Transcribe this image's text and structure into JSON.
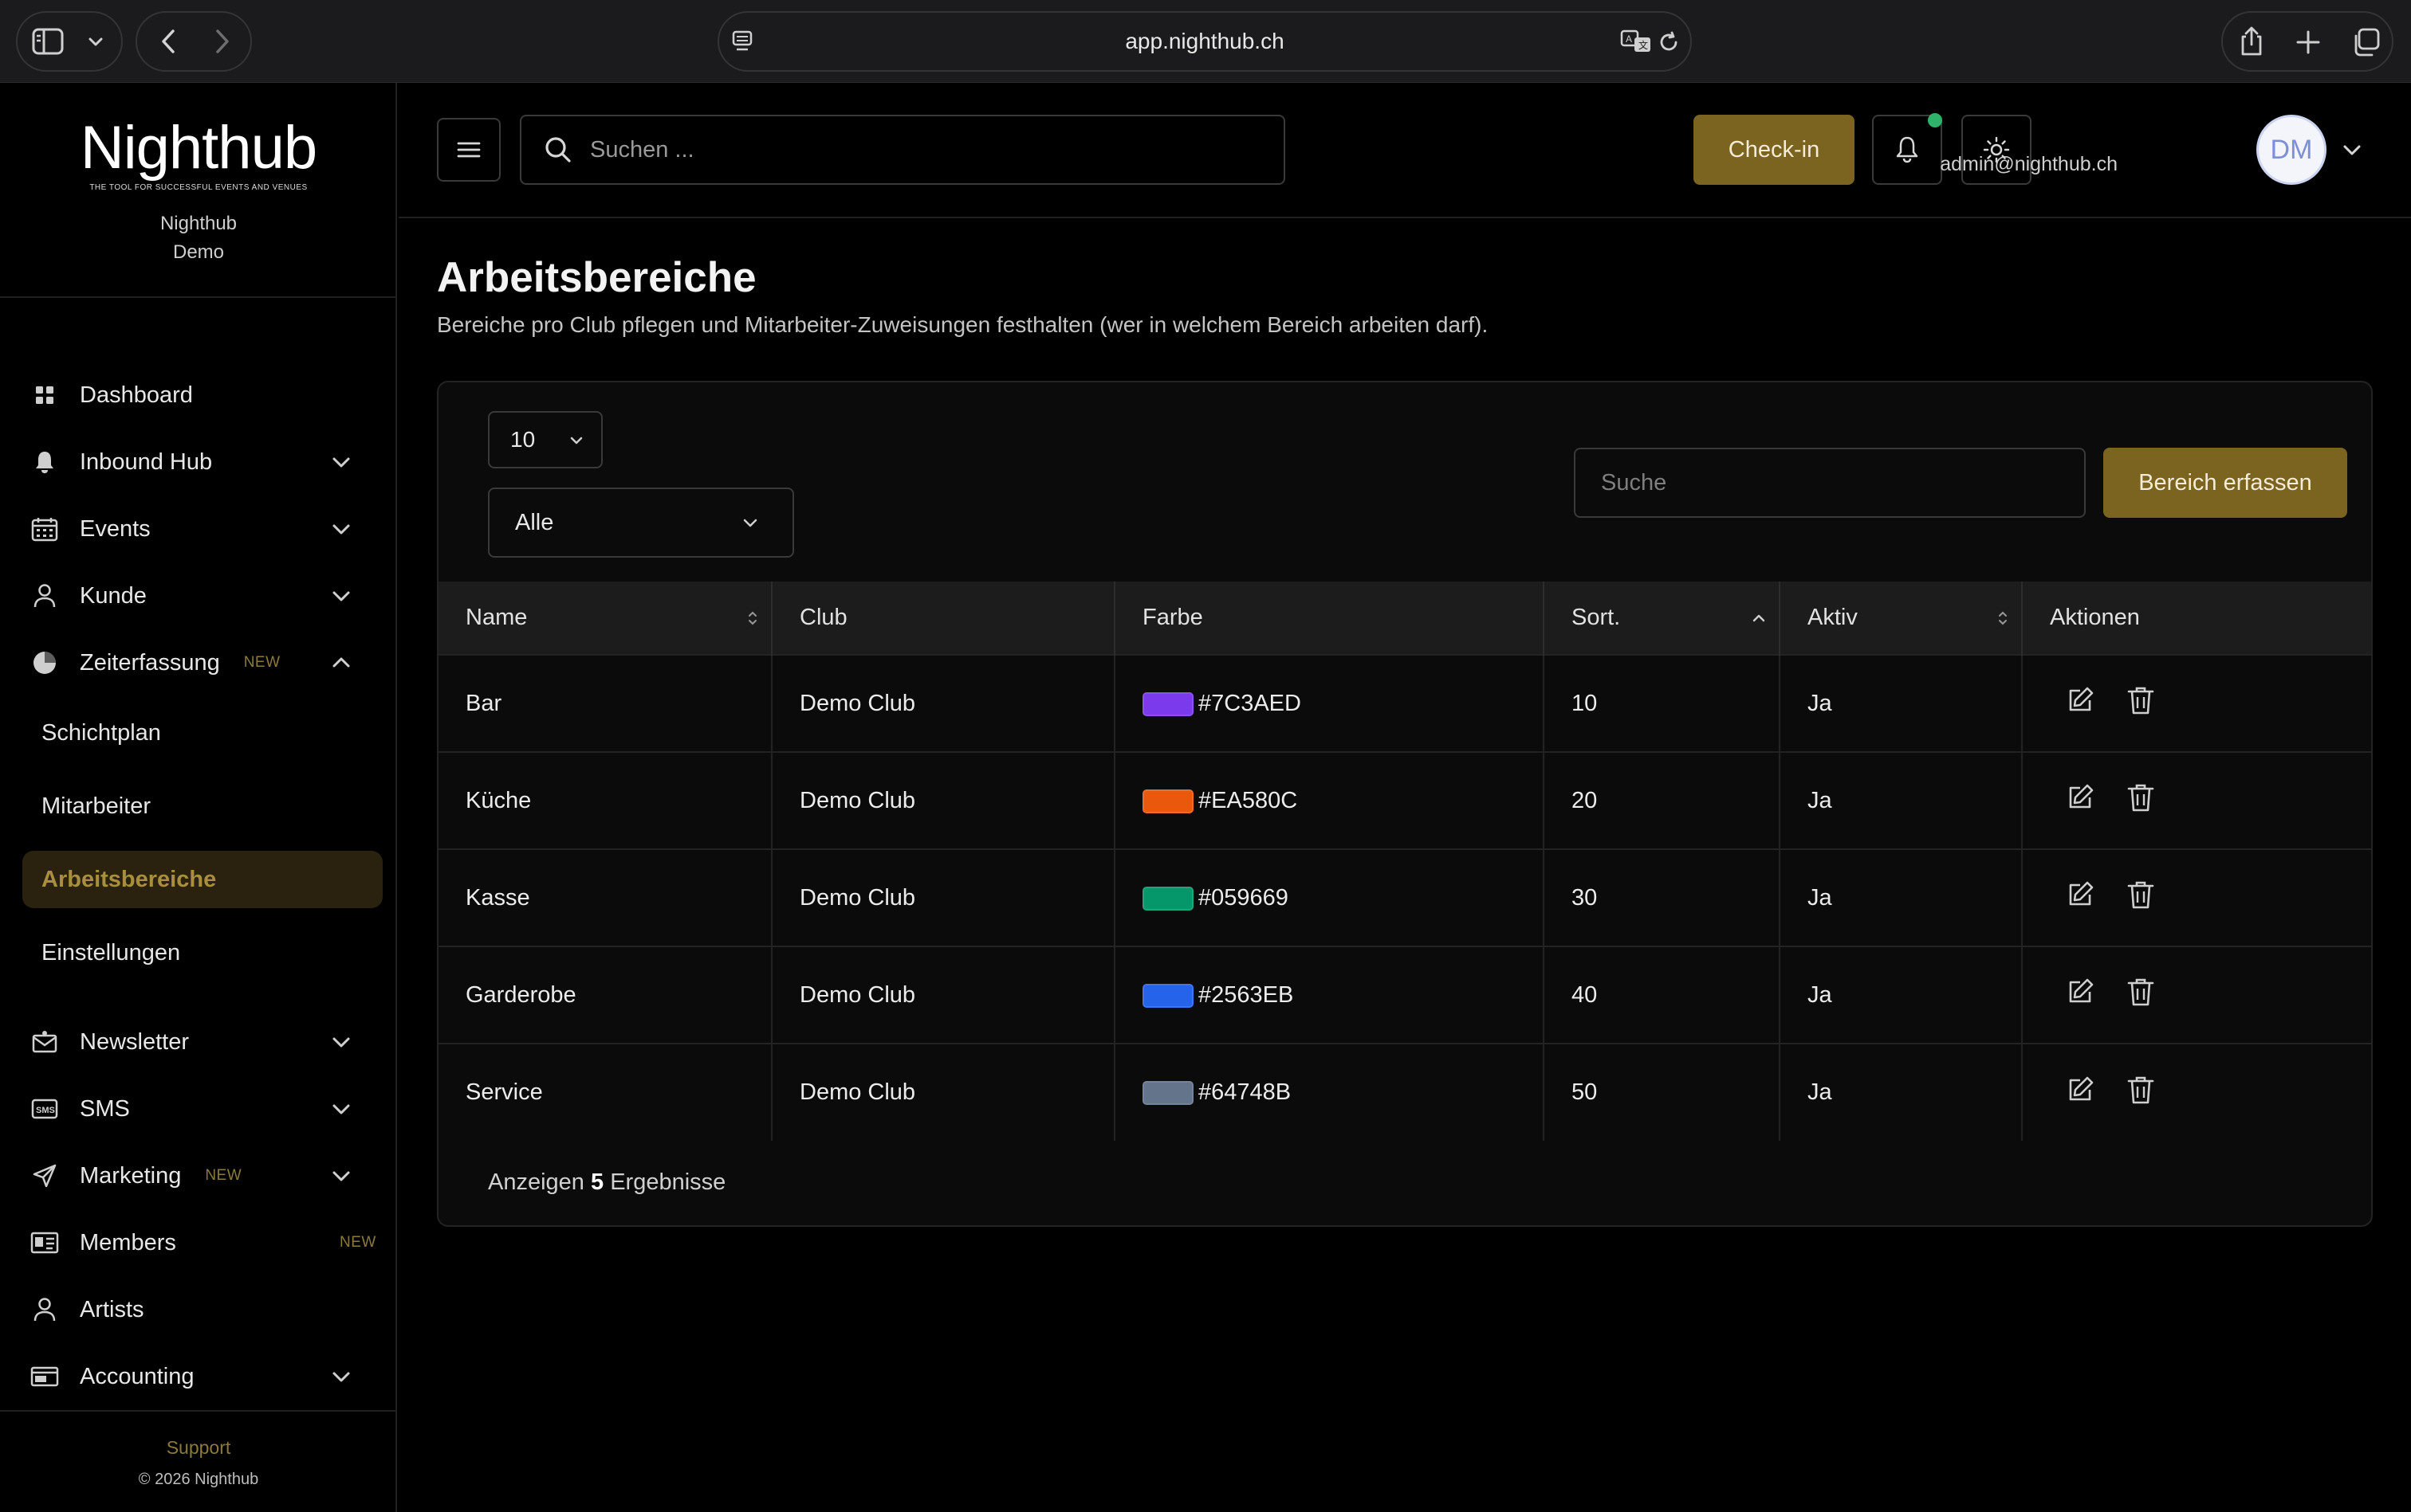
{
  "browser": {
    "url": "app.nighthub.ch"
  },
  "sidebar": {
    "brand": "Nighthub",
    "tagline": "THE TOOL FOR SUCCESSFUL EVENTS AND VENUES",
    "org_line1": "Nighthub",
    "org_line2": "Demo",
    "items": [
      {
        "label": "Dashboard",
        "icon": "grid-icon"
      },
      {
        "label": "Inbound Hub",
        "icon": "bell-icon",
        "expandable": true
      },
      {
        "label": "Events",
        "icon": "calendar-icon",
        "expandable": true
      },
      {
        "label": "Kunde",
        "icon": "user-icon",
        "expandable": true
      },
      {
        "label": "Zeiterfassung",
        "icon": "clock-icon",
        "badge": "NEW",
        "expanded": true
      }
    ],
    "sub_items": [
      {
        "label": "Schichtplan"
      },
      {
        "label": "Mitarbeiter"
      },
      {
        "label": "Arbeitsbereiche",
        "active": true
      },
      {
        "label": "Einstellungen"
      }
    ],
    "items_after": [
      {
        "label": "Newsletter",
        "icon": "newsletter-icon",
        "expandable": true
      },
      {
        "label": "SMS",
        "icon": "sms-icon",
        "expandable": true
      },
      {
        "label": "Marketing",
        "icon": "send-icon",
        "badge": "NEW",
        "expandable": true
      },
      {
        "label": "Members",
        "icon": "id-card-icon",
        "badge": "NEW"
      },
      {
        "label": "Artists",
        "icon": "user-icon"
      },
      {
        "label": "Accounting",
        "icon": "wallet-icon",
        "expandable": true
      }
    ],
    "support": "Support",
    "copyright": "© 2026 Nighthub"
  },
  "topbar": {
    "search_placeholder": "Suchen ...",
    "checkin_label": "Check-in",
    "user_email": "admin@nighthub.ch",
    "avatar_initials": "DM"
  },
  "page": {
    "title": "Arbeitsbereiche",
    "description": "Bereiche pro Club pflegen und Mitarbeiter-Zuweisungen festhalten (wer in welchem Bereich arbeiten darf)."
  },
  "table": {
    "page_size": "10",
    "filter": "Alle",
    "search_placeholder": "Suche",
    "add_label": "Bereich erfassen",
    "columns": [
      "Name",
      "Club",
      "Farbe",
      "Sort.",
      "Aktiv",
      "Aktionen"
    ],
    "rows": [
      {
        "name": "Bar",
        "club": "Demo Club",
        "color": "#7C3AED",
        "sort": "10",
        "active": "Ja"
      },
      {
        "name": "Küche",
        "club": "Demo Club",
        "color": "#EA580C",
        "sort": "20",
        "active": "Ja"
      },
      {
        "name": "Kasse",
        "club": "Demo Club",
        "color": "#059669",
        "sort": "30",
        "active": "Ja"
      },
      {
        "name": "Garderobe",
        "club": "Demo Club",
        "color": "#2563EB",
        "sort": "40",
        "active": "Ja"
      },
      {
        "name": "Service",
        "club": "Demo Club",
        "color": "#64748B",
        "sort": "50",
        "active": "Ja"
      }
    ],
    "footer_prefix": "Anzeigen",
    "footer_count": "5",
    "footer_suffix": "Ergebnisse"
  },
  "colors": {
    "accent": "#7A6420",
    "accent_text": "#A88E3E",
    "status_dot": "#2FB36A"
  }
}
